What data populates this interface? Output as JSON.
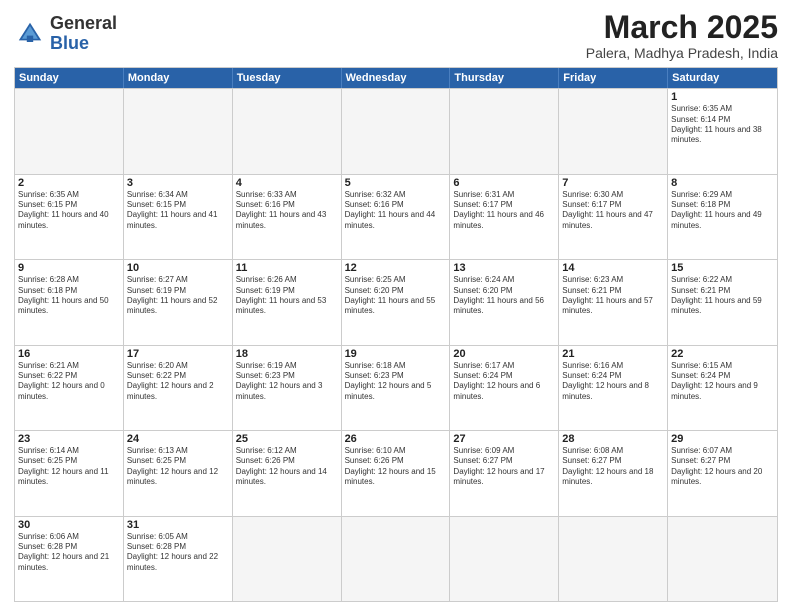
{
  "header": {
    "logo_general": "General",
    "logo_blue": "Blue",
    "month_title": "March 2025",
    "subtitle": "Palera, Madhya Pradesh, India"
  },
  "days_of_week": [
    "Sunday",
    "Monday",
    "Tuesday",
    "Wednesday",
    "Thursday",
    "Friday",
    "Saturday"
  ],
  "weeks": [
    [
      {
        "day": "",
        "empty": true
      },
      {
        "day": "",
        "empty": true
      },
      {
        "day": "",
        "empty": true
      },
      {
        "day": "",
        "empty": true
      },
      {
        "day": "",
        "empty": true
      },
      {
        "day": "",
        "empty": true
      },
      {
        "day": "1",
        "sunrise": "Sunrise: 6:35 AM",
        "sunset": "Sunset: 6:14 PM",
        "daylight": "Daylight: 11 hours and 38 minutes."
      }
    ],
    [
      {
        "day": "2",
        "sunrise": "Sunrise: 6:35 AM",
        "sunset": "Sunset: 6:15 PM",
        "daylight": "Daylight: 11 hours and 40 minutes."
      },
      {
        "day": "3",
        "sunrise": "Sunrise: 6:34 AM",
        "sunset": "Sunset: 6:15 PM",
        "daylight": "Daylight: 11 hours and 41 minutes."
      },
      {
        "day": "4",
        "sunrise": "Sunrise: 6:33 AM",
        "sunset": "Sunset: 6:16 PM",
        "daylight": "Daylight: 11 hours and 43 minutes."
      },
      {
        "day": "5",
        "sunrise": "Sunrise: 6:32 AM",
        "sunset": "Sunset: 6:16 PM",
        "daylight": "Daylight: 11 hours and 44 minutes."
      },
      {
        "day": "6",
        "sunrise": "Sunrise: 6:31 AM",
        "sunset": "Sunset: 6:17 PM",
        "daylight": "Daylight: 11 hours and 46 minutes."
      },
      {
        "day": "7",
        "sunrise": "Sunrise: 6:30 AM",
        "sunset": "Sunset: 6:17 PM",
        "daylight": "Daylight: 11 hours and 47 minutes."
      },
      {
        "day": "8",
        "sunrise": "Sunrise: 6:29 AM",
        "sunset": "Sunset: 6:18 PM",
        "daylight": "Daylight: 11 hours and 49 minutes."
      }
    ],
    [
      {
        "day": "9",
        "sunrise": "Sunrise: 6:28 AM",
        "sunset": "Sunset: 6:18 PM",
        "daylight": "Daylight: 11 hours and 50 minutes."
      },
      {
        "day": "10",
        "sunrise": "Sunrise: 6:27 AM",
        "sunset": "Sunset: 6:19 PM",
        "daylight": "Daylight: 11 hours and 52 minutes."
      },
      {
        "day": "11",
        "sunrise": "Sunrise: 6:26 AM",
        "sunset": "Sunset: 6:19 PM",
        "daylight": "Daylight: 11 hours and 53 minutes."
      },
      {
        "day": "12",
        "sunrise": "Sunrise: 6:25 AM",
        "sunset": "Sunset: 6:20 PM",
        "daylight": "Daylight: 11 hours and 55 minutes."
      },
      {
        "day": "13",
        "sunrise": "Sunrise: 6:24 AM",
        "sunset": "Sunset: 6:20 PM",
        "daylight": "Daylight: 11 hours and 56 minutes."
      },
      {
        "day": "14",
        "sunrise": "Sunrise: 6:23 AM",
        "sunset": "Sunset: 6:21 PM",
        "daylight": "Daylight: 11 hours and 57 minutes."
      },
      {
        "day": "15",
        "sunrise": "Sunrise: 6:22 AM",
        "sunset": "Sunset: 6:21 PM",
        "daylight": "Daylight: 11 hours and 59 minutes."
      }
    ],
    [
      {
        "day": "16",
        "sunrise": "Sunrise: 6:21 AM",
        "sunset": "Sunset: 6:22 PM",
        "daylight": "Daylight: 12 hours and 0 minutes."
      },
      {
        "day": "17",
        "sunrise": "Sunrise: 6:20 AM",
        "sunset": "Sunset: 6:22 PM",
        "daylight": "Daylight: 12 hours and 2 minutes."
      },
      {
        "day": "18",
        "sunrise": "Sunrise: 6:19 AM",
        "sunset": "Sunset: 6:23 PM",
        "daylight": "Daylight: 12 hours and 3 minutes."
      },
      {
        "day": "19",
        "sunrise": "Sunrise: 6:18 AM",
        "sunset": "Sunset: 6:23 PM",
        "daylight": "Daylight: 12 hours and 5 minutes."
      },
      {
        "day": "20",
        "sunrise": "Sunrise: 6:17 AM",
        "sunset": "Sunset: 6:24 PM",
        "daylight": "Daylight: 12 hours and 6 minutes."
      },
      {
        "day": "21",
        "sunrise": "Sunrise: 6:16 AM",
        "sunset": "Sunset: 6:24 PM",
        "daylight": "Daylight: 12 hours and 8 minutes."
      },
      {
        "day": "22",
        "sunrise": "Sunrise: 6:15 AM",
        "sunset": "Sunset: 6:24 PM",
        "daylight": "Daylight: 12 hours and 9 minutes."
      }
    ],
    [
      {
        "day": "23",
        "sunrise": "Sunrise: 6:14 AM",
        "sunset": "Sunset: 6:25 PM",
        "daylight": "Daylight: 12 hours and 11 minutes."
      },
      {
        "day": "24",
        "sunrise": "Sunrise: 6:13 AM",
        "sunset": "Sunset: 6:25 PM",
        "daylight": "Daylight: 12 hours and 12 minutes."
      },
      {
        "day": "25",
        "sunrise": "Sunrise: 6:12 AM",
        "sunset": "Sunset: 6:26 PM",
        "daylight": "Daylight: 12 hours and 14 minutes."
      },
      {
        "day": "26",
        "sunrise": "Sunrise: 6:10 AM",
        "sunset": "Sunset: 6:26 PM",
        "daylight": "Daylight: 12 hours and 15 minutes."
      },
      {
        "day": "27",
        "sunrise": "Sunrise: 6:09 AM",
        "sunset": "Sunset: 6:27 PM",
        "daylight": "Daylight: 12 hours and 17 minutes."
      },
      {
        "day": "28",
        "sunrise": "Sunrise: 6:08 AM",
        "sunset": "Sunset: 6:27 PM",
        "daylight": "Daylight: 12 hours and 18 minutes."
      },
      {
        "day": "29",
        "sunrise": "Sunrise: 6:07 AM",
        "sunset": "Sunset: 6:27 PM",
        "daylight": "Daylight: 12 hours and 20 minutes."
      }
    ],
    [
      {
        "day": "30",
        "sunrise": "Sunrise: 6:06 AM",
        "sunset": "Sunset: 6:28 PM",
        "daylight": "Daylight: 12 hours and 21 minutes."
      },
      {
        "day": "31",
        "sunrise": "Sunrise: 6:05 AM",
        "sunset": "Sunset: 6:28 PM",
        "daylight": "Daylight: 12 hours and 22 minutes."
      },
      {
        "day": "",
        "empty": true
      },
      {
        "day": "",
        "empty": true
      },
      {
        "day": "",
        "empty": true
      },
      {
        "day": "",
        "empty": true
      },
      {
        "day": "",
        "empty": true
      }
    ]
  ]
}
